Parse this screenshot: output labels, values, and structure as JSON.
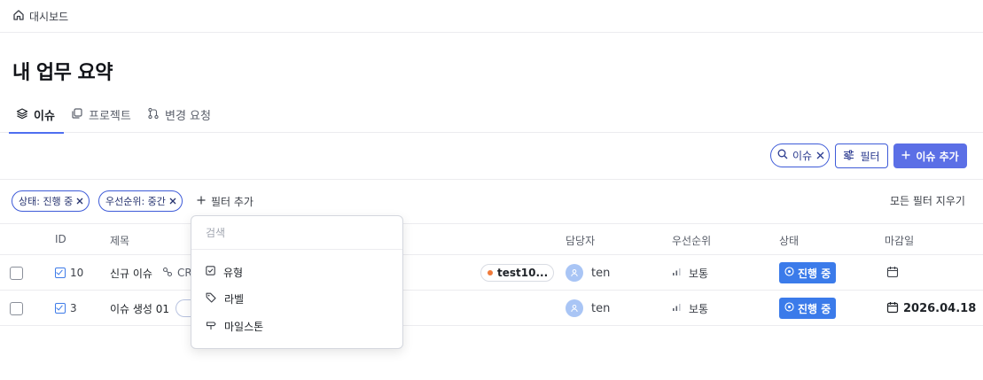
{
  "breadcrumb": {
    "label": "대시보드"
  },
  "page": {
    "title": "내 업무 요약"
  },
  "tabs": [
    {
      "label": "이슈"
    },
    {
      "label": "프로젝트"
    },
    {
      "label": "변경 요청"
    }
  ],
  "toolbar": {
    "search_chip": "이슈",
    "filter_label": "필터",
    "add_label": "이슈 추가"
  },
  "filters": {
    "chips": [
      "상태: 진행 중",
      "우선순위: 중간"
    ],
    "add_filter": "필터 추가",
    "clear_all": "모든 필터 지우기"
  },
  "dropdown": {
    "placeholder": "검색",
    "items": [
      "유형",
      "라벨",
      "마일스톤"
    ]
  },
  "table": {
    "headers": [
      "ID",
      "제목",
      "담당자",
      "우선순위",
      "상태",
      "마감일"
    ],
    "rows": [
      {
        "id": "10",
        "title": "신규 이슈",
        "title_extra": "CR",
        "label": "test10...",
        "assignee": "ten",
        "priority": "보통",
        "status": "진행 중",
        "due": ""
      },
      {
        "id": "3",
        "title": "이슈 생성 01",
        "title_extra": "",
        "label": "",
        "assignee": "ten",
        "priority": "보통",
        "status": "진행 중",
        "due": "2026.04.18"
      }
    ]
  },
  "colors": {
    "accent": "#5b6fe6",
    "status": "#3b7bea",
    "label_dot": "#f07a3a"
  }
}
